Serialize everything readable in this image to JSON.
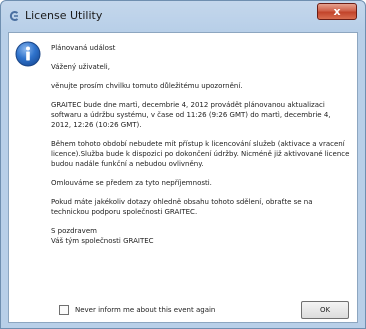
{
  "window": {
    "title": "License Utility",
    "close_glyph": "x"
  },
  "message": {
    "paragraphs": [
      "Plánovaná událost",
      "Vážený uživateli,",
      "věnujte prosím chvilku tomuto důležitému upozornění.",
      "GRAITEC bude dne martì, decembrie 4, 2012 provádět plánovanou aktualizaci softwaru a údržbu systému, v čase od 11:26 (9:26 GMT) do martì, decembrie 4, 2012, 12:26 (10:26 GMT).",
      "Během tohoto období nebudete mít přístup k licencování služeb (aktivace a vracení licence).Služba bude k dispozici po dokončení údržby. Nicméně již aktivované licence budou nadále funkční a nebudou ovlivněny.",
      "Omlouváme se předem za tyto nepříjemnosti.",
      "Pokud máte jakékoliv dotazy ohledně obsahu tohoto sdělení, obraťte se na technickou podporu společnosti GRAITEC."
    ],
    "signature": [
      "S pozdravem",
      "Váš tým společnosti GRAITEC"
    ]
  },
  "footer": {
    "checkbox_label": "Never inform me about this event again",
    "checkbox_checked": false,
    "ok_label": "OK"
  },
  "icons": {
    "app": "license-app-icon",
    "info": "info-icon"
  },
  "colors": {
    "title_bar": "#b8cfe8",
    "close_button": "#c2442b",
    "info_icon": "#1f5fb8"
  }
}
